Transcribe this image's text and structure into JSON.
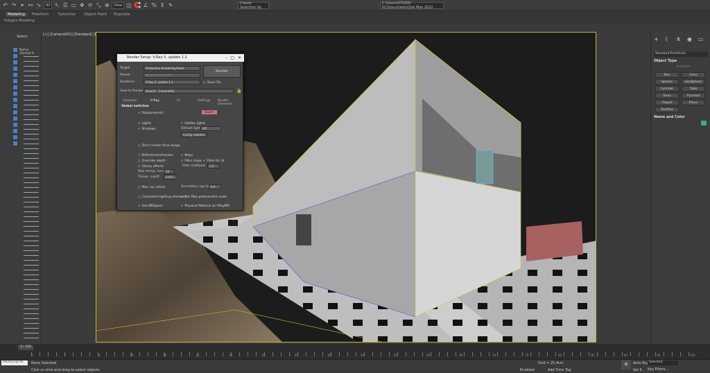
{
  "toolbar": {
    "filter_label": "All",
    "view_label": "View",
    "selection_set_placeholder": "Create Selection Se",
    "path": "C:\\Users\\STUDIO PC\\Documents\\3ds Max 2022"
  },
  "ribbon": {
    "tabs": [
      "Modeling",
      "Freeform",
      "Selection",
      "Object Paint",
      "Populate"
    ],
    "subtab": "Polygon Modeling"
  },
  "scene_explorer": {
    "select_label": "Select",
    "column": "Name (Sorted A"
  },
  "viewport": {
    "label": "[+] [Camera001] [Standard] [Default Flat]"
  },
  "right_panel": {
    "dropdown": "Standard Primitives",
    "object_type_title": "Object Type",
    "autogrid_label": "AutoGrid",
    "buttons": [
      "Box",
      "Cone",
      "Sphere",
      "GeoSphere",
      "Cylinder",
      "Tube",
      "Torus",
      "Pyramid",
      "Teapot",
      "Plane",
      "TextPlus"
    ],
    "name_color_title": "Name and Color"
  },
  "render_setup": {
    "title": "Render Setup: V-Ray 5, update 1.2",
    "target_label": "Target:",
    "target_value": "Production Rendering Mode",
    "preset_label": "Preset:",
    "preset_value": "No preset selected",
    "renderer_label": "Renderer:",
    "renderer_value": "V-Ray 5, update 1.2",
    "save_file_label": "Save File",
    "render_button": "Render",
    "view_label": "View to Render:",
    "view_value": "Quad 4 - Camera001",
    "tabs": [
      "Common",
      "V-Ray",
      "GI",
      "Settings",
      "Render Elements"
    ],
    "section": "Global switches",
    "displacement": "Displacement",
    "mode_badge": "Expert",
    "lights": "Lights",
    "hidden_lights": "Hidden lights",
    "shadows": "Shadows",
    "default_lights": "Default lights",
    "default_lights_value": "Off",
    "full_gi_value": "Full lig. solution",
    "dont_render_final": "Don't render final image",
    "reflection_refraction": "Reflection/refraction",
    "maps": "Maps",
    "override_depth": "Override depth",
    "filter_maps": "Filter maps",
    "filter_for_gi": "Filter for GI",
    "glossy_effects": "Glossy effects",
    "filter_multiplier": "Filter multiplier",
    "filter_multiplier_value": "1,0",
    "max_transp_label": "Max transp. levels",
    "max_transp_value": "50",
    "transp_cutoff_label": "Transp. cutoff",
    "transp_cutoff_value": "0,001",
    "max_ray_intens": "Max ray intens",
    "secondary_rays_bias": "Secondary rays bias",
    "secondary_rays_value": "0,0",
    "consistent_lighting": "Consistent lighting elements",
    "photometric_scale": "3ds Max photometric scale",
    "use_mtlspace": "Use MtlSpace",
    "physical_material": "Physical Material as VRayMtl"
  },
  "timeline": {
    "frame": "0 / 100",
    "ticks": [
      "0",
      "5",
      "10",
      "15",
      "20",
      "25",
      "30",
      "35",
      "40",
      "45",
      "50",
      "55",
      "60",
      "65",
      "70",
      "75",
      "80",
      "85",
      "90",
      "95",
      "100"
    ]
  },
  "status": {
    "script_box": "MAXScript Mi",
    "selection": "None Selected",
    "prompt": "Click or click-and-drag to select objects",
    "grid": "Grid = 25,4cm",
    "add_time_tag": "Add Time Tag",
    "enabled_label": "Enabled:",
    "auto_key": "Auto Key",
    "selected": "Selected",
    "set_key": "Set K.",
    "key_filters": "Key Filters..."
  }
}
